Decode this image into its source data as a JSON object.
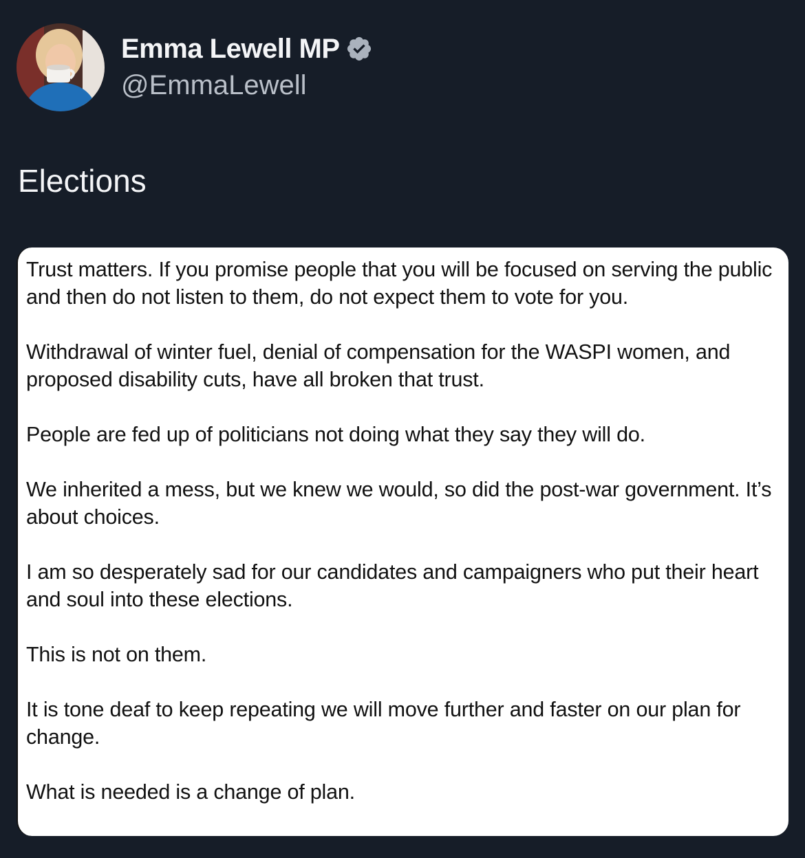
{
  "author": {
    "display_name": "Emma Lewell MP",
    "handle": "@EmmaLewell",
    "verified_icon": "verified-badge-icon",
    "avatar_icon": "profile-avatar"
  },
  "post": {
    "title": "Elections",
    "note_paragraphs": [
      "Trust matters.  If you promise people that you will be focused on serving the public and then do not listen to them, do not expect them to vote for you.",
      "Withdrawal of winter fuel, denial of compensation for the WASPI women, and proposed disability cuts, have all broken that trust.",
      "People are fed up of politicians not doing what they say they will do.",
      "We inherited a mess, but we knew we would, so did the post-war government. It’s about choices.",
      "I am so desperately sad for our candidates and campaigners who put their heart and soul into these elections.",
      "This is not on them.",
      "It is tone deaf to keep repeating we will move further and faster on our plan for change.",
      "What is needed is a change of plan."
    ]
  },
  "colors": {
    "background": "#161d28",
    "name_text": "#f4f5f7",
    "handle_text": "#b9bfc8",
    "badge": "#aab2bd",
    "card_background": "#ffffff",
    "card_text": "#111111"
  }
}
